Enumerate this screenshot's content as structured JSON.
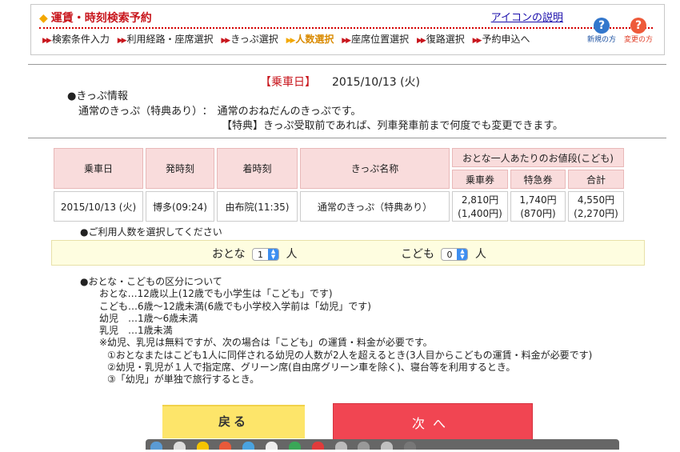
{
  "header": {
    "title": "運賃・時刻検索予約",
    "help_link": "アイコンの説明",
    "steps": [
      "検索条件入力",
      "利用経路・座席選択",
      "きっぷ選択",
      "人数選択",
      "座席位置選択",
      "復路選択",
      "予約申込へ"
    ],
    "active_step_index": 3,
    "help_icons": [
      {
        "label": "新規の方",
        "icon": "question-icon",
        "color": "#3377cc"
      },
      {
        "label": "変更の方",
        "icon": "question-icon",
        "color": "#ee5a3a"
      }
    ]
  },
  "ride_date": {
    "label": "【乗車日】",
    "value": "2015/10/13 (火)"
  },
  "ticket_info": {
    "heading": "●きっぷ情報",
    "name": "通常のきっぷ（特典あり）",
    "separator": "：",
    "description": "通常のおねだんのきっぷです。",
    "tokuten": "【特典】きっぷ受取前であれば、列車発車前まで何度でも変更できます。"
  },
  "table": {
    "headers": {
      "date": "乗車日",
      "depart": "発時刻",
      "arrive": "着時刻",
      "ticket_name": "きっぷ名称",
      "price_group": "おとな一人あたりのお値段(こども)",
      "fare": "乗車券",
      "express": "特急券",
      "total": "合計"
    },
    "row": {
      "date": "2015/10/13 (火)",
      "depart": "博多(09:24)",
      "arrive": "由布院(11:35)",
      "ticket_name": "通常のきっぷ（特典あり）",
      "fare": "2,810円",
      "fare_child": "(1,400円)",
      "express": "1,740円",
      "express_child": "(870円)",
      "total": "4,550円",
      "total_child": "(2,270円)"
    }
  },
  "count": {
    "heading": "●ご利用人数を選択してください",
    "adult_label": "おとな",
    "adult_value": "1",
    "child_label": "こども",
    "child_value": "0",
    "unit": "人"
  },
  "notes": {
    "heading": "●おとな・こどもの区分について",
    "lines": [
      "おとな…12歳以上(12歳でも小学生は「こども」です)",
      "こども…6歳〜12歳未満(6歳でも小学校入学前は「幼児」です)",
      "幼児　…1歳〜6歳未満",
      "乳児　…1歳未満",
      "※幼児、乳児は無料ですが、次の場合は「こども」の運賃・料金が必要です。",
      "①おとなまたはこども1人に同伴される幼児の人数が2人を超えるとき(3人目からこどもの運賃・料金が必要です)",
      "②幼児・乳児が１人で指定席、グリーン席(自由席グリーン車を除く)、寝台等を利用するとき。",
      "③「幼児」が単独で旅行するとき。"
    ]
  },
  "buttons": {
    "back": "戻る",
    "next": "次へ"
  }
}
